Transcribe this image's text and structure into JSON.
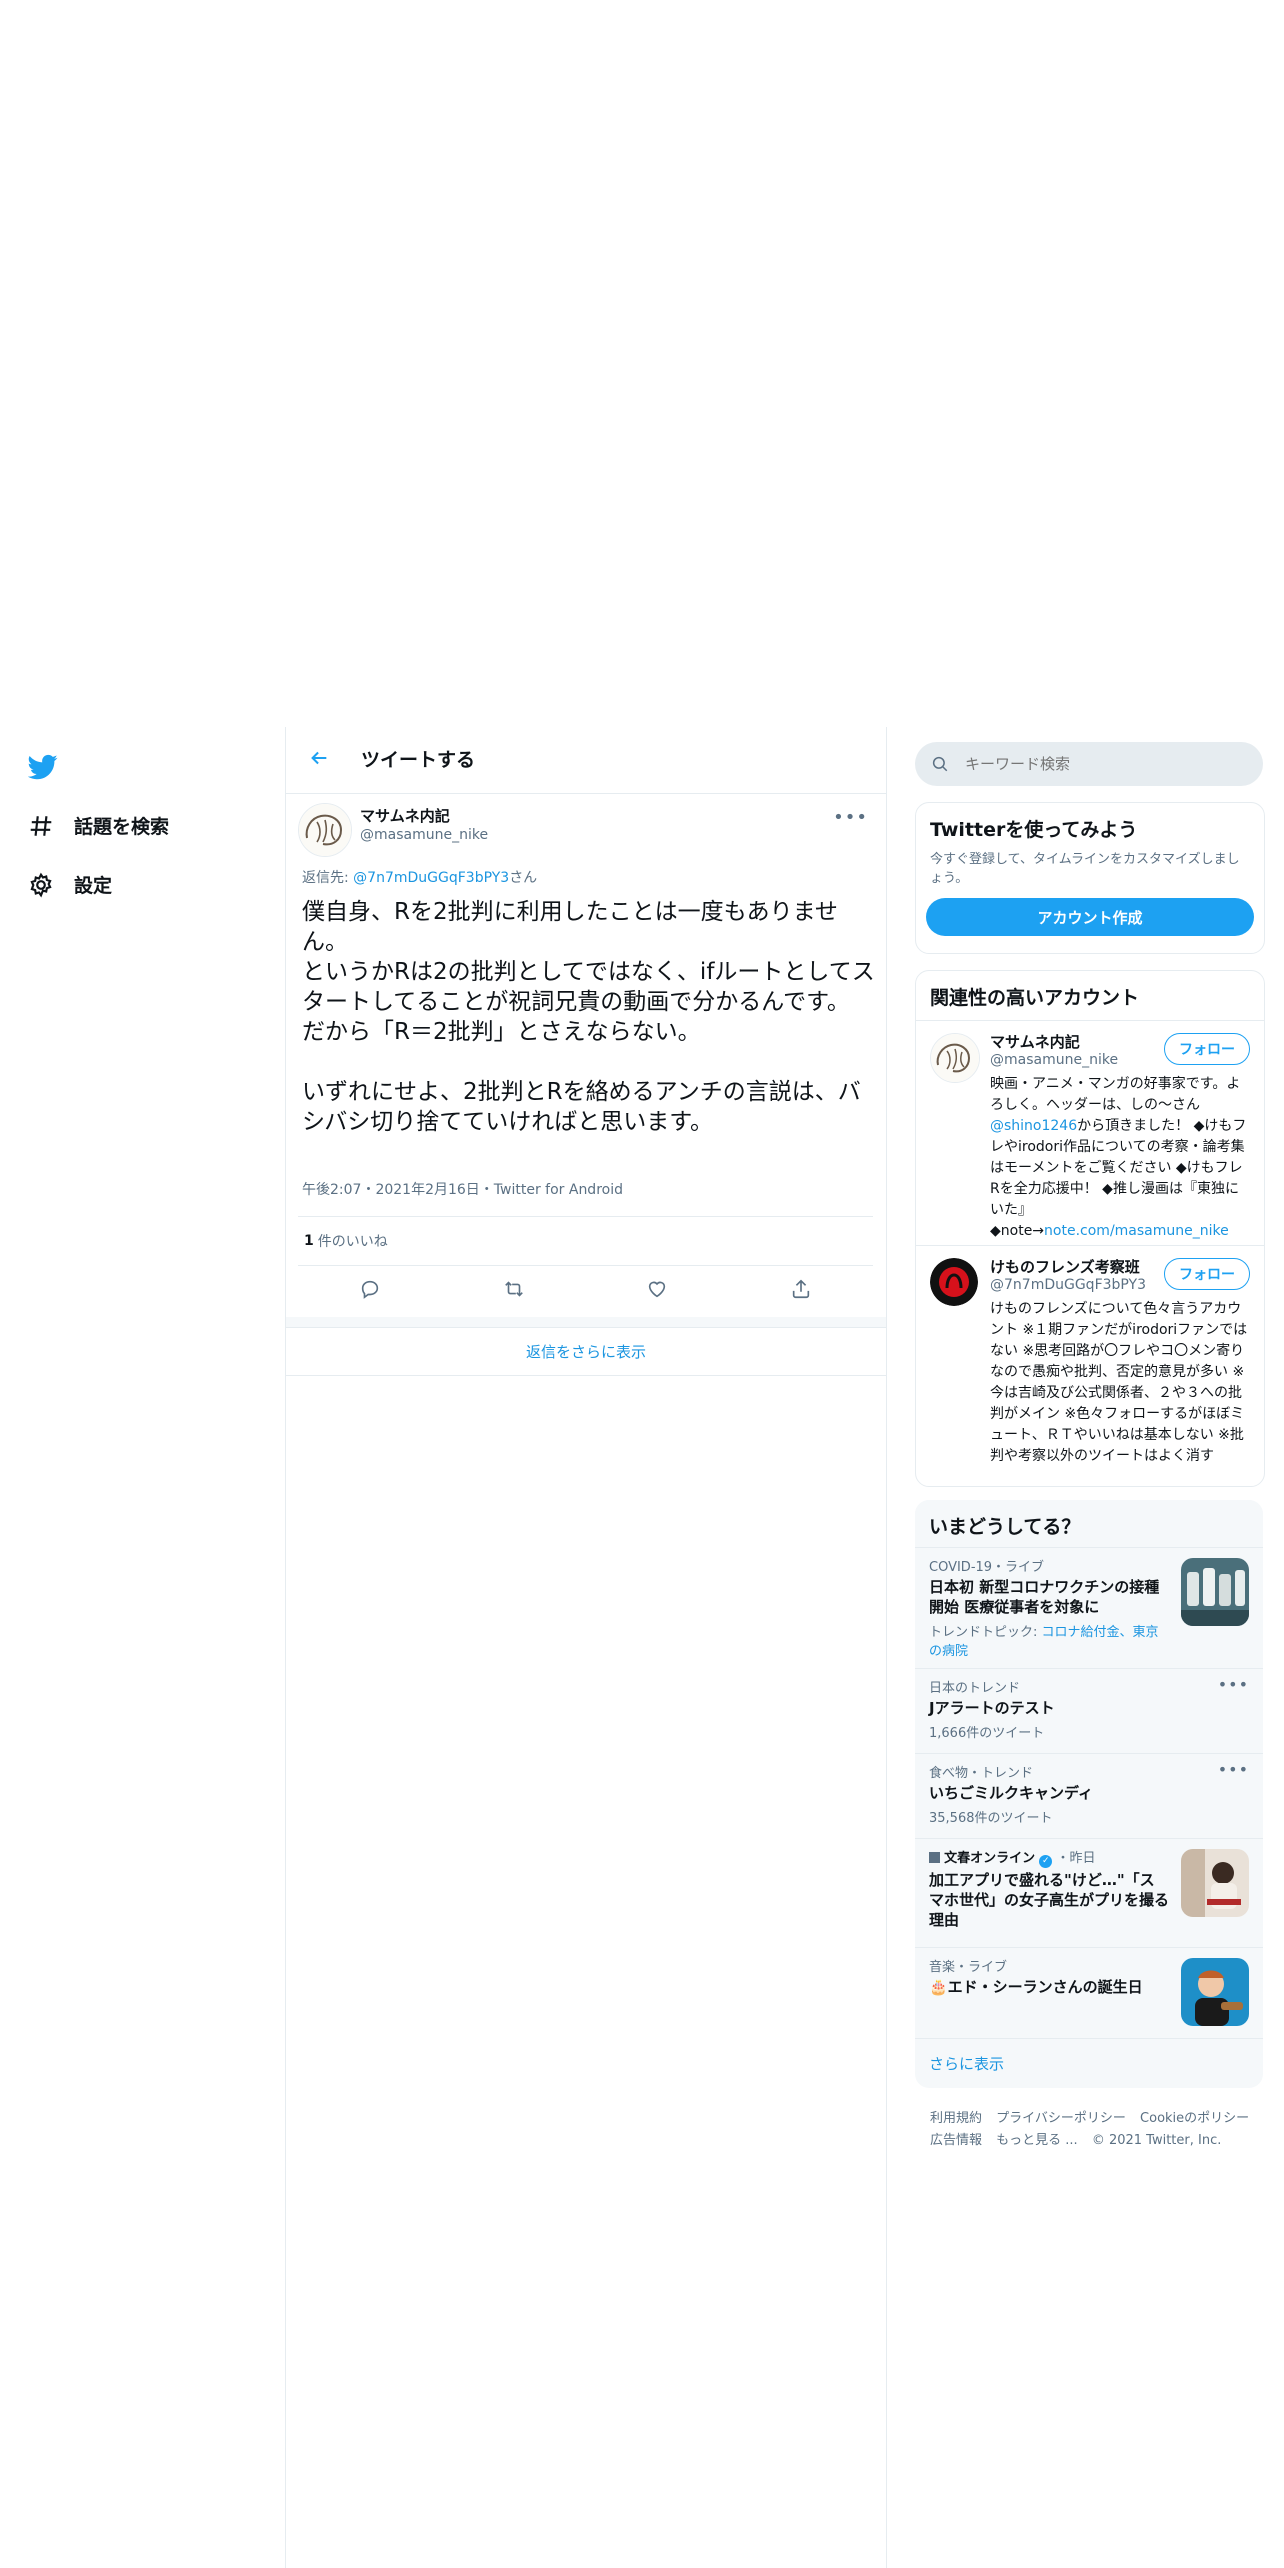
{
  "nav": {
    "logo": "twitter-bird-icon",
    "items": [
      {
        "label": "話題を検索",
        "icon": "hashtag-icon"
      },
      {
        "label": "設定",
        "icon": "gear-icon"
      }
    ]
  },
  "header": {
    "title": "ツイートする"
  },
  "tweet": {
    "author_name": "マサムネ内記",
    "author_handle": "@masamune_nike",
    "reply_prefix": "返信先: ",
    "reply_to": "@7n7mDuGGqF3bPY3",
    "reply_suffix": "さん",
    "text": "僕自身、Rを2批判に利用したことは一度もありません。\nというかRは2の批判としてではなく、ifルートとしてスタートしてることが祝詞兄貴の動画で分かるんです。\nだから「R＝2批判」とさえならない。\n\nいずれにせよ、2批判とRを絡めるアンチの言説は、バシバシ切り捨てていければと思います。",
    "meta": "午後2:07・2021年2月16日・Twitter for Android",
    "likes_count": "1",
    "likes_label": "件のいいね",
    "actions": [
      "reply-icon",
      "retweet-icon",
      "like-icon",
      "share-icon"
    ],
    "show_more_replies": "返信をさらに表示"
  },
  "search": {
    "placeholder": "キーワード検索"
  },
  "signup": {
    "title": "Twitterを使ってみよう",
    "desc": "今すぐ登録して、タイムラインをカスタマイズしましょう。",
    "button": "アカウント作成"
  },
  "related": {
    "title": "関連性の高いアカウント",
    "follow_label": "フォロー",
    "accounts": [
      {
        "name": "マサムネ内記",
        "handle": "@masamune_nike",
        "bio_a": "映画・アニメ・マンガの好事家です。よろしく。ヘッダーは、しの〜さん",
        "bio_link": "@shino1246",
        "bio_b": "から頂きました！ ◆けもフレやirodori作品についての考察・論考集はモーメントをご覧ください ◆けもフレRを全力応援中！ ◆推し漫画は『東独にいた』 ◆note→",
        "bio_link2": "note.com/masamune_nike"
      },
      {
        "name": "けものフレンズ考察班",
        "handle": "@7n7mDuGGqF3bPY3",
        "bio_a": "けものフレンズについて色々言うアカウント ※１期ファンだがirodoriファンではない ※思考回路が〇フレやコ〇メン寄りなので愚痴や批判、否定的意見が多い ※今は吉崎及び公式関係者、２や３への批判がメイン ※色々フォローするがほぼミュート、ＲＴやいいねは基本しない ※批判や考察以外のツイートはよく消す"
      }
    ]
  },
  "trends": {
    "title": "いまどうしてる？",
    "items": [
      {
        "context": "COVID-19・ライブ",
        "title": "日本初 新型コロナワクチンの接種開始 医療従事者を対象に",
        "sub_prefix": "トレンドトピック: ",
        "sub_links": "コロナ給付金、東京の病院"
      },
      {
        "context": "日本のトレンド",
        "title": "Jアラートのテスト",
        "sub": "1,666件のツイート"
      },
      {
        "context": "食べ物・トレンド",
        "title": "いちごミルクキャンディ",
        "sub": "35,568件のツイート"
      },
      {
        "source": "文春オンライン",
        "time": "・昨日",
        "title": "加工アプリで盛れる\"けど…\"「スマホ世代」の女子高生がプリを撮る理由"
      },
      {
        "context": "音楽・ライブ",
        "title": "🎂エド・シーランさんの誕生日"
      }
    ],
    "show_more": "さらに表示"
  },
  "footer": {
    "links": [
      "利用規約",
      "プライバシーポリシー",
      "Cookieのポリシー",
      "広告情報",
      "もっと見る ..."
    ],
    "copyright": "© 2021 Twitter, Inc."
  }
}
